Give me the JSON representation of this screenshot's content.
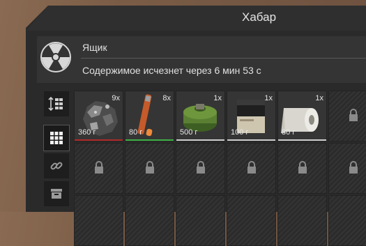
{
  "window": {
    "title": "Хабар"
  },
  "container": {
    "name": "Ящик",
    "timer_text": "Содержимое исчезнет через 6 мин 53 с"
  },
  "sidebar": {
    "buttons": [
      {
        "icon": "sort-icon"
      },
      {
        "icon": "grid-icon",
        "active": true
      },
      {
        "icon": "link-icon"
      },
      {
        "icon": "archive-icon"
      }
    ]
  },
  "items": [
    {
      "name": "ore-chunk",
      "quantity": "9x",
      "weight": "360 г",
      "bar_color": "#b22b2b"
    },
    {
      "name": "flare-stick",
      "quantity": "8x",
      "weight": "80 г",
      "bar_color": "#3fb24a"
    },
    {
      "name": "gas-mask-filter",
      "quantity": "1x",
      "weight": "500 г",
      "bar_color": "#cfcfcf"
    },
    {
      "name": "battery-pack",
      "quantity": "1x",
      "weight": "100 г",
      "bar_color": "#cfcfcf"
    },
    {
      "name": "toilet-paper-roll",
      "quantity": "1x",
      "weight": "80 г",
      "bar_color": "#cfcfcf"
    }
  ]
}
